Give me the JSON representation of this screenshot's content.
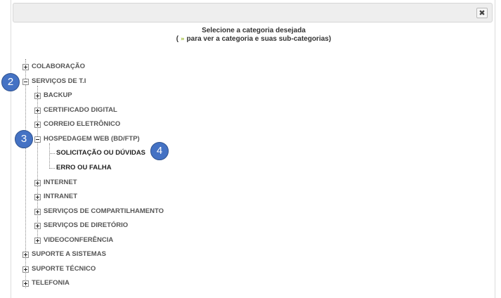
{
  "dialog": {
    "close_icon": "✖",
    "heading_line1": "Selecione a categoria desejada",
    "heading_line2_prefix": "(",
    "heading_chevron": "»",
    "heading_line2_suffix": "para ver a categoria e suas sub-categorias)"
  },
  "tree": {
    "colaboracao": "COLABORAÇÃO",
    "servicos_ti": "SERVIÇOS DE T.I",
    "backup": "BACKUP",
    "certificado": "CERTIFICADO DIGITAL",
    "correio": "CORREIO ELETRÔNICO",
    "hospedagem": "HOSPEDAGEM WEB (BD/FTP)",
    "solicitacao": "SOLICITAÇÃO OU DÚVIDAS",
    "erro": "ERRO OU FALHA",
    "internet": "INTERNET",
    "intranet": "INTRANET",
    "compartilhamento": "SERVIÇOS DE COMPARTILHAMENTO",
    "diretorio": "SERVIÇOS DE DIRETÓRIO",
    "videoconferencia": "VIDEOCONFERÊNCIA",
    "suporte_sistemas": "SUPORTE A SISTEMAS",
    "suporte_tecnico": "SUPORTE TÉCNICO",
    "telefonia": "TELEFONIA"
  },
  "badges": {
    "b2": "2",
    "b3": "3",
    "b4": "4"
  },
  "colors": {
    "badge": "#4472c4",
    "chevron": "#9aba2c"
  }
}
